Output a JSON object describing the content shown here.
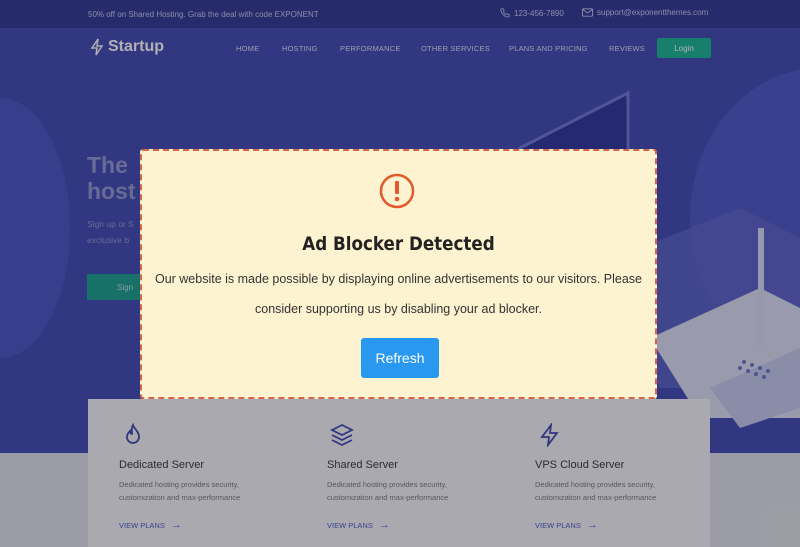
{
  "topbar": {
    "promo": "50% off on Shared Hosting. Grab the deal with code EXPONENT",
    "phone": "123-456-7890",
    "email": "support@exponentthemes.com"
  },
  "header": {
    "brand": "Startup",
    "nav": [
      "HOME",
      "HOSTING",
      "PERFORMANCE",
      "OTHER SERVICES",
      "PLANS AND PRICING",
      "REVIEWS"
    ],
    "login_label": "Login"
  },
  "hero": {
    "title_line1": "The",
    "title_line2": "host",
    "text_line1": "Sign up or S",
    "text_line2": "exclusive b",
    "cta_label": "Sign"
  },
  "services": [
    {
      "icon": "flame-icon",
      "title": "Dedicated Server",
      "desc": "Dedicated hosting provides security, customization and max-performance",
      "link": "VIEW PLANS"
    },
    {
      "icon": "layers-icon",
      "title": "Shared Server",
      "desc": "Dedicated hosting provides security, customization and max-performance",
      "link": "VIEW PLANS"
    },
    {
      "icon": "bolt-icon",
      "title": "VPS Cloud Server",
      "desc": "Dedicated hosting provides security, customization and max-performance",
      "link": "VIEW PLANS"
    }
  ],
  "modal": {
    "icon": "exclamation-icon",
    "title": "Ad Blocker Detected",
    "message": "Our website is made possible by displaying online advertisements to our visitors. Please consider supporting us by disabling your ad blocker.",
    "button_label": "Refresh"
  },
  "colors": {
    "hero_bg": "#3d46b0",
    "accent_green": "#17b492",
    "modal_bg": "#fdf3d0",
    "modal_border": "#d9644a",
    "refresh_button": "#2998f0"
  }
}
